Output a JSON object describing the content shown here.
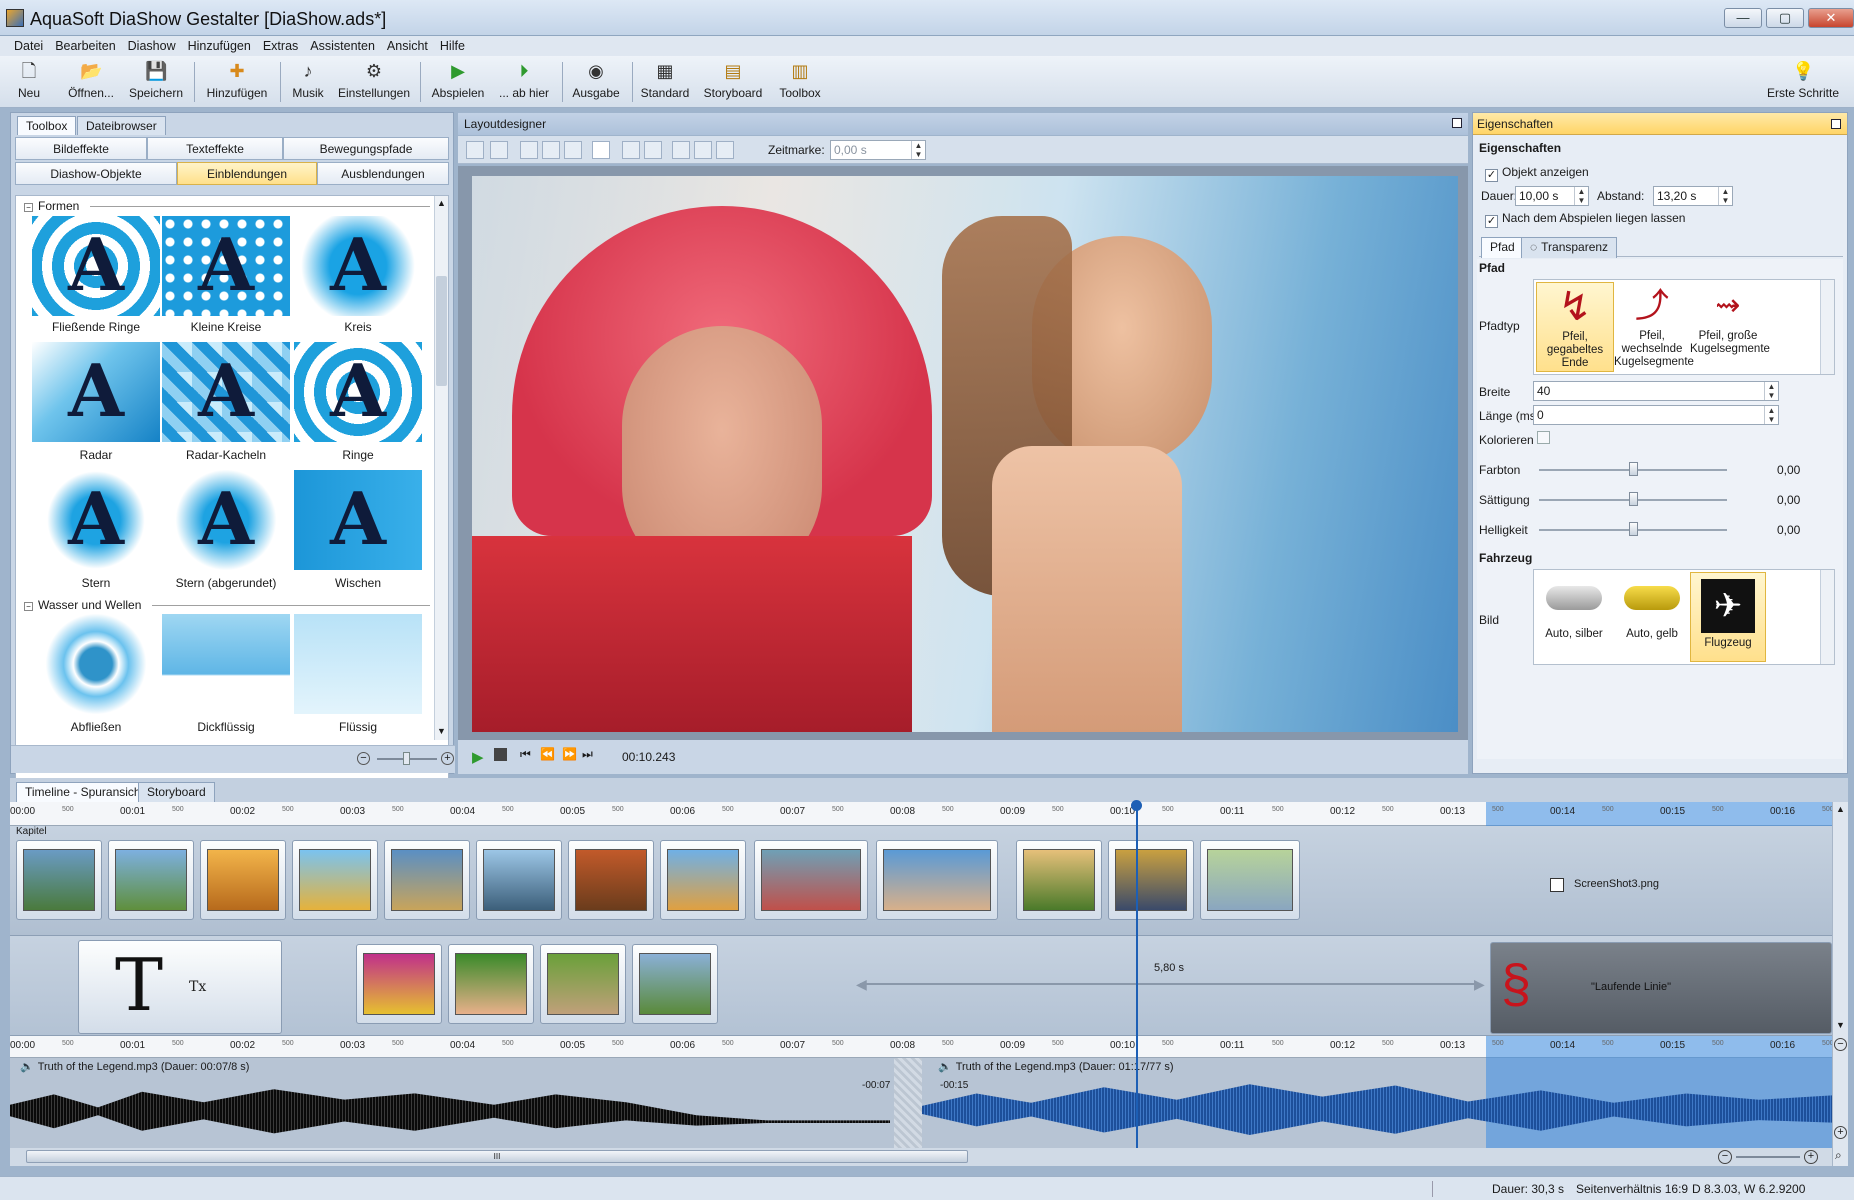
{
  "window": {
    "title": "AquaSoft DiaShow Gestalter [DiaShow.ads*]",
    "min": "—",
    "max": "▢",
    "close": "✕"
  },
  "menu": [
    "Datei",
    "Bearbeiten",
    "Diashow",
    "Hinzufügen",
    "Extras",
    "Assistenten",
    "Ansicht",
    "Hilfe"
  ],
  "toolbar": {
    "new": "Neu",
    "open": "Öffnen...",
    "save": "Speichern",
    "add": "Hinzufügen",
    "music": "Musik",
    "settings": "Einstellungen",
    "play": "Abspielen",
    "play_from": "... ab hier",
    "output": "Ausgabe",
    "standard": "Standard",
    "storyboard": "Storyboard",
    "toolbox": "Toolbox",
    "first_steps": "Erste Schritte"
  },
  "left": {
    "tabs": [
      "Toolbox",
      "Dateibrowser"
    ],
    "subtabs_row1": [
      "Bildeffekte",
      "Texteffekte",
      "Bewegungspfade"
    ],
    "subtabs_row2": [
      "Diashow-Objekte",
      "Einblendungen",
      "Ausblendungen"
    ],
    "group1": "Formen",
    "group2": "Wasser und Wellen",
    "items": [
      "Fließende Ringe",
      "Kleine Kreise",
      "Kreis",
      "Radar",
      "Radar-Kacheln",
      "Ringe",
      "Stern",
      "Stern (abgerundet)",
      "Wischen",
      "Abfließen",
      "Dickflüssig",
      "Flüssig"
    ],
    "thumb_letter": "A"
  },
  "layout": {
    "title": "Layoutdesigner",
    "zeitmarke_label": "Zeitmarke:",
    "zeitmarke_value": "0,00 s",
    "time": "00:10.243"
  },
  "props": {
    "header": "Eigenschaften",
    "section": "Eigenschaften",
    "show_object": "Objekt anzeigen",
    "duration_label": "Dauer:",
    "duration_value": "10,00 s",
    "distance_label": "Abstand:",
    "distance_value": "13,20 s",
    "leave_after": "Nach dem Abspielen liegen lassen",
    "tabs": [
      "Pfad",
      "Transparenz"
    ],
    "path_section": "Pfad",
    "pfadtyp_label": "Pfadtyp",
    "path_items": [
      "Pfeil, gegabeltes Ende",
      "Pfeil, wechselnde Kugelsegmente",
      "Pfeil, große Kugelsegmente"
    ],
    "breite_label": "Breite",
    "breite_value": "40",
    "laenge_label": "Länge (ms)",
    "laenge_value": "0",
    "kolorieren_label": "Kolorieren",
    "farbton_label": "Farbton",
    "farbton_value": "0,00",
    "saettigung_label": "Sättigung",
    "saettigung_value": "0,00",
    "helligkeit_label": "Helligkeit",
    "helligkeit_value": "0,00",
    "vehicle_section": "Fahrzeug",
    "bild_label": "Bild",
    "vehicles": [
      "Auto, silber",
      "Auto, gelb",
      "Flugzeug"
    ]
  },
  "timeline": {
    "tabs": [
      "Timeline - Spuransicht",
      "Storyboard"
    ],
    "ruler": [
      "00:00",
      "00:01",
      "00:02",
      "00:03",
      "00:04",
      "00:05",
      "00:06",
      "00:07",
      "00:08",
      "00:09",
      "00:10",
      "00:11",
      "00:12",
      "00:13",
      "00:14",
      "00:15",
      "00:16"
    ],
    "half_tick": "500",
    "chapter_label": "Kapitel",
    "screenshot_label": "ScreenShot3.png",
    "gap_label": "5,80 s",
    "running_line_label": "\"Laufende Linie\"",
    "text_clip_big": "T",
    "text_clip_small": "Tx",
    "audio1": "Truth of the Legend.mp3 (Dauer: 00:07/8 s)",
    "audio2": "Truth of the Legend.mp3 (Dauer: 01:17/77 s)",
    "audio1_fade": "-00:07",
    "audio2_fade": "-00:15",
    "hscroll_grip": "III"
  },
  "status": {
    "duration": "Dauer: 30,3 s",
    "ratio": "Seitenverhältnis 16:9",
    "version": "D 8.3.03, W 6.2.9200"
  }
}
